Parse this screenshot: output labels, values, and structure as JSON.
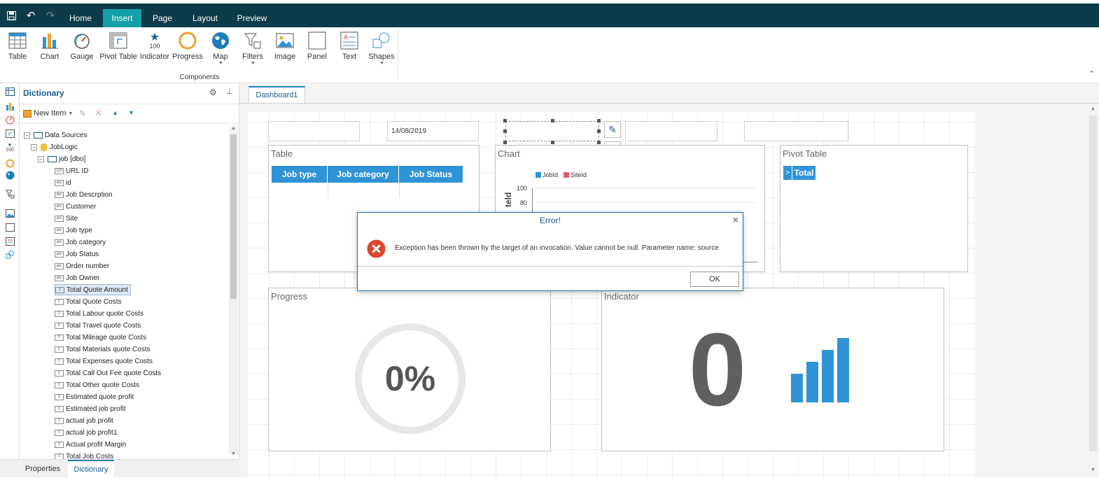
{
  "menu": {
    "tabs": [
      {
        "label": "Home"
      },
      {
        "label": "Insert"
      },
      {
        "label": "Page"
      },
      {
        "label": "Layout"
      },
      {
        "label": "Preview"
      }
    ],
    "active_tab": "Insert"
  },
  "ribbon": {
    "buttons": [
      {
        "label": "Table",
        "icon": "table-icon"
      },
      {
        "label": "Chart",
        "icon": "chart-icon"
      },
      {
        "label": "Gauge",
        "icon": "gauge-icon"
      },
      {
        "label": "Pivot Table",
        "icon": "pivot-table-icon"
      },
      {
        "label": "Indicator",
        "icon": "indicator-icon",
        "sub": "100"
      },
      {
        "label": "Progress",
        "icon": "progress-icon"
      },
      {
        "label": "Map",
        "icon": "map-icon"
      },
      {
        "label": "Filters",
        "icon": "filters-icon"
      },
      {
        "label": "Image",
        "icon": "image-icon"
      },
      {
        "label": "Panel",
        "icon": "panel-icon"
      },
      {
        "label": "Text",
        "icon": "text-icon"
      },
      {
        "label": "Shapes",
        "icon": "shapes-icon"
      }
    ],
    "group_label": "Components"
  },
  "dictionary": {
    "title": "Dictionary",
    "new_item_label": "New Item",
    "tree": {
      "data_sources": "Data Sources",
      "connection": "JobLogic",
      "table": "job [dbo]",
      "fields": [
        {
          "label": "URL ID",
          "type": "123"
        },
        {
          "label": "id",
          "type": "abc"
        },
        {
          "label": "Job Descrption",
          "type": "abc"
        },
        {
          "label": "Customer",
          "type": "abc"
        },
        {
          "label": "Site",
          "type": "abc"
        },
        {
          "label": "Job type",
          "type": "abc"
        },
        {
          "label": "Job category",
          "type": "abc"
        },
        {
          "label": "Job Status",
          "type": "abc"
        },
        {
          "label": "Order number",
          "type": "abc"
        },
        {
          "label": "Job Owner",
          "type": "abc"
        },
        {
          "label": "Total Quote Amount",
          "type": "Σ"
        },
        {
          "label": "Total Quote Costs",
          "type": "Σ"
        },
        {
          "label": "Total Labour quote Costs",
          "type": "Σ"
        },
        {
          "label": "Total Travel quote Costs",
          "type": "Σ"
        },
        {
          "label": "Total Mileage quote Costs",
          "type": "Σ"
        },
        {
          "label": "Total Materials quote Costs",
          "type": "Σ"
        },
        {
          "label": "Total Expenses quote Costs",
          "type": "Σ"
        },
        {
          "label": "Total Call Out Fee quote Costs",
          "type": "Σ"
        },
        {
          "label": "Total Other quote Costs",
          "type": "Σ"
        },
        {
          "label": "Estimated quote profit",
          "type": "Σ"
        },
        {
          "label": "Estimated job profit",
          "type": "Σ"
        },
        {
          "label": "actual job profit",
          "type": "Σ"
        },
        {
          "label": "actual job profit1",
          "type": "Σ"
        },
        {
          "label": "Actual profit Margin",
          "type": "Σ"
        },
        {
          "label": "Total Job Costs",
          "type": "Σ"
        }
      ],
      "selected": "Total Quote Amount"
    }
  },
  "bottom_tabs": [
    {
      "label": "Properties"
    },
    {
      "label": "Dictionary"
    }
  ],
  "document_tab": "Dashboard1",
  "filters": {
    "date_value": "14/08/2019"
  },
  "widgets": {
    "table": {
      "title": "Table",
      "columns": [
        "Job type",
        "Job category",
        "Job Status"
      ]
    },
    "chart": {
      "title": "Chart",
      "legend": [
        "JobId",
        "SiteId"
      ],
      "y_ticks": [
        "100",
        "80"
      ],
      "axis_label": "teld"
    },
    "pivot": {
      "title": "Pivot Table",
      "expand": ">",
      "total": "Total"
    },
    "progress": {
      "title": "Progress",
      "value": "0%",
      "fraction": 0
    },
    "indicator": {
      "title": "Indicator",
      "value": "0"
    }
  },
  "dialog": {
    "title": "Error!",
    "message": "Exception has been thrown by the target of an invocation. Value cannot be null. Parameter name: source",
    "ok_label": "OK"
  },
  "colors": {
    "titlebar": "#0c3c4b",
    "active_tab": "#14a0a8",
    "accent_blue": "#2e94d6",
    "error_red": "#d9472f",
    "legend_red": "#e8596b"
  }
}
